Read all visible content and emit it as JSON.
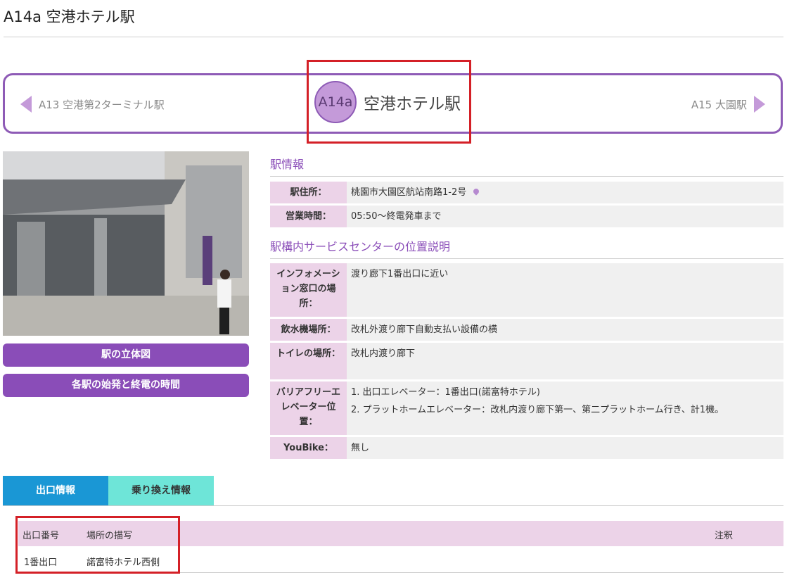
{
  "page": {
    "title": "A14a 空港ホテル駅"
  },
  "nav": {
    "prev_label": "A13 空港第2ターミナル駅",
    "current_code": "A14a",
    "current_name": "空港ホテル駅",
    "next_label": "A15 大園駅"
  },
  "buttons": {
    "diagram": "駅の立体図",
    "timetable": "各駅の始発と終電の時間"
  },
  "station_info": {
    "heading": "駅情報",
    "rows": [
      {
        "label": "駅住所：",
        "value": "桃園市大園区航站南路1-2号"
      },
      {
        "label": "営業時間：",
        "value": "05:50～終電発車まで"
      }
    ]
  },
  "service_center": {
    "heading": "駅構内サービスセンターの位置説明",
    "rows": [
      {
        "label": "インフォメーション窓口の場所：",
        "value": "渡り廊下1番出口に近い"
      },
      {
        "label": "飲水機場所：",
        "value": "改札外渡り廊下自動支払い設備の横"
      },
      {
        "label": "トイレの場所：",
        "value": "改札内渡り廊下"
      },
      {
        "label": "バリアフリーエレベーター位置：",
        "values": [
          "1. 出口エレベーター：1番出口(諾富特ホテル)",
          "2. プラットホームエレベーター：改札内渡り廊下第一、第二プラットホーム行き、計1機。"
        ]
      },
      {
        "label": "YouBike：",
        "value": "無し"
      }
    ]
  },
  "tabs": [
    {
      "label": "出口情報",
      "active": true
    },
    {
      "label": "乗り換え情報",
      "active": false
    }
  ],
  "exits": {
    "headers": [
      "出口番号",
      "場所の描写",
      "注釈"
    ],
    "rows": [
      {
        "number": "1番出口",
        "description": "諾富特ホテル西側",
        "note": ""
      }
    ]
  },
  "colors": {
    "brand_purple": "#8a4db8",
    "label_pink": "#ecd3e8",
    "tab_blue": "#1a97d5",
    "tab_teal": "#6ee5d8",
    "highlight_red": "#d42027"
  }
}
